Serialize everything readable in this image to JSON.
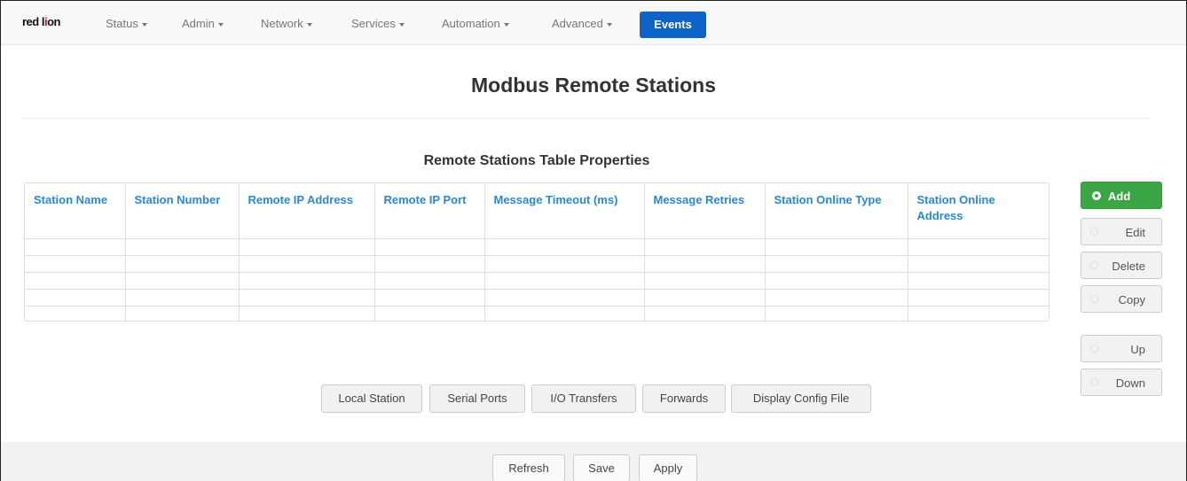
{
  "navbar": {
    "logo": {
      "part1": "red l",
      "part2": "i",
      "part3": "on"
    },
    "items": [
      {
        "label": "Status"
      },
      {
        "label": "Admin"
      },
      {
        "label": "Network"
      },
      {
        "label": "Services"
      },
      {
        "label": "Automation"
      },
      {
        "label": "Advanced"
      }
    ],
    "active": {
      "label": "Events"
    }
  },
  "page": {
    "title": "Modbus Remote Stations",
    "section_title": "Remote Stations Table Properties"
  },
  "table": {
    "columns": [
      "Station Name",
      "Station Number",
      "Remote IP Address",
      "Remote IP Port",
      "Message Timeout (ms)",
      "Message Retries",
      "Station Online Type",
      "Station Online Address"
    ],
    "rows": 5
  },
  "side_actions": {
    "add": "Add",
    "edit": "Edit",
    "delete": "Delete",
    "copy": "Copy",
    "up": "Up",
    "down": "Down"
  },
  "actions": {
    "local_station": "Local Station",
    "serial_ports": "Serial Ports",
    "io_transfers": "I/O Transfers",
    "forwards": "Forwards",
    "display_config": "Display Config File"
  },
  "footer": {
    "refresh": "Refresh",
    "save": "Save",
    "apply": "Apply"
  },
  "colors": {
    "accent": "#0d63c7",
    "add_button": "#3ca546",
    "header_text": "#2a88d0"
  }
}
